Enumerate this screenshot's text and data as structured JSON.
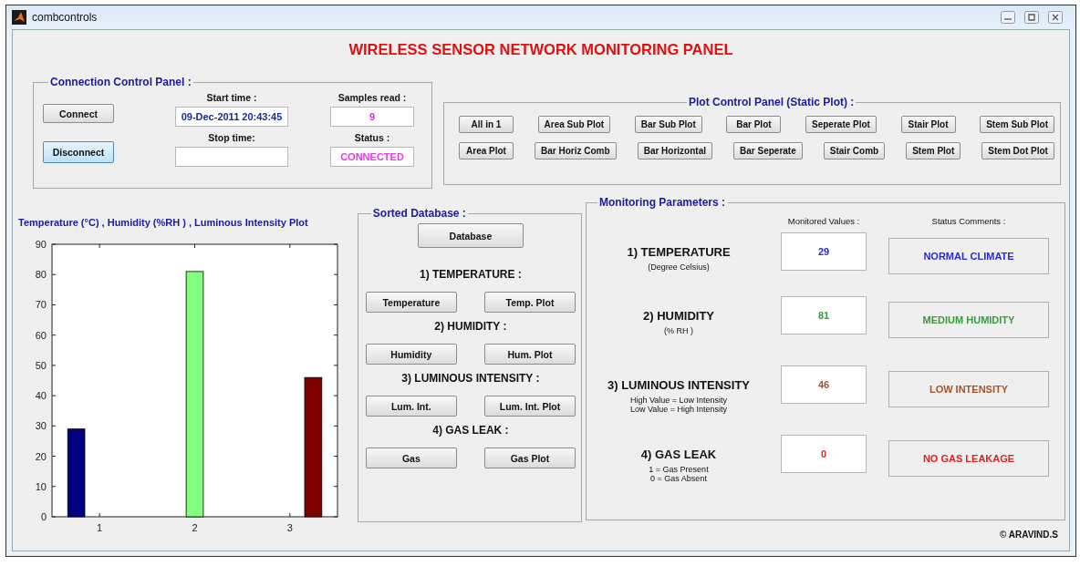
{
  "window": {
    "title": "combcontrols"
  },
  "header": "WIRELESS SENSOR NETWORK MONITORING PANEL",
  "connection_panel": {
    "title": "Connection Control Panel :",
    "buttons": [
      {
        "label": "Connect",
        "focused": false
      },
      {
        "label": "Disconnect",
        "focused": true
      }
    ],
    "fields": [
      {
        "label": "Start time :",
        "value": "09-Dec-2011 20:43:45",
        "kind": "time"
      },
      {
        "label": "Samples read :",
        "value": "9",
        "kind": "count"
      },
      {
        "label": "Stop time:",
        "kind": "time"
      },
      {
        "label": "Status :",
        "value": "CONNECTED",
        "kind": "status"
      }
    ]
  },
  "plot_control_panel": {
    "title": "Plot Control Panel (Static Plot) :",
    "rows": [
      [
        "All in 1",
        "Area Sub Plot",
        "Bar Sub Plot",
        "Bar Plot",
        "Seperate Plot",
        "Stair Plot",
        "Stem Sub Plot"
      ],
      [
        "Area Plot",
        "Bar Horiz Comb",
        "Bar Horizontal",
        "Bar Seperate",
        "Stair Comb",
        "Stem Plot",
        "Stem Dot Plot"
      ]
    ]
  },
  "plot": {
    "title": "Temperature (°C) , Humidity (%RH ) , Luminous Intensity Plot",
    "chart_data": {
      "type": "bar",
      "categories": [
        "1",
        "2",
        "3"
      ],
      "series": [
        {
          "color": "#000080",
          "values": [
            29,
            null,
            null
          ]
        },
        {
          "color": "#80ff80",
          "values": [
            null,
            81,
            null
          ]
        },
        {
          "color": "#800000",
          "values": [
            null,
            null,
            46
          ]
        }
      ],
      "ylim": [
        0,
        90
      ],
      "yticks": [
        0,
        10,
        20,
        30,
        40,
        50,
        60,
        70,
        80,
        90
      ]
    }
  },
  "sorted_database": {
    "title": "Sorted Database :",
    "database_button": "Database",
    "sections": [
      {
        "heading": "1) TEMPERATURE :",
        "buttons": [
          "Temperature",
          "Temp. Plot"
        ]
      },
      {
        "heading": "2) HUMIDITY :",
        "buttons": [
          "Humidity",
          "Hum. Plot"
        ]
      },
      {
        "heading": "3) LUMINOUS INTENSITY :",
        "buttons": [
          "Lum. Int.",
          "Lum. Int. Plot"
        ]
      },
      {
        "heading": "4) GAS LEAK :",
        "buttons": [
          "Gas",
          "Gas Plot"
        ]
      }
    ]
  },
  "monitoring": {
    "title": "Monitoring Parameters :",
    "value_header": "Monitored Values :",
    "comment_header": "Status Comments :",
    "rows": [
      {
        "name": "1) TEMPERATURE",
        "notes": [
          "(Degree Celsius)"
        ],
        "value": "29",
        "comment": "NORMAL CLIMATE",
        "color": "#2a2ad0"
      },
      {
        "name": "2) HUMIDITY",
        "notes": [
          "(% RH )"
        ],
        "value": "81",
        "comment": "MEDIUM HUMIDITY",
        "color": "#3a9a3a"
      },
      {
        "name": "3) LUMINOUS INTENSITY",
        "notes": [
          "High Value = Low Intensity",
          "Low Value = High Intensity"
        ],
        "value": "46",
        "comment": "LOW INTENSITY",
        "color": "#a8522a"
      },
      {
        "name": "4) GAS LEAK",
        "notes": [
          "1 = Gas Present",
          "0 = Gas Absent"
        ],
        "value": "0",
        "comment": "NO GAS LEAKAGE",
        "color": "#e02222"
      }
    ]
  },
  "copyright": "© ARAVIND.S"
}
